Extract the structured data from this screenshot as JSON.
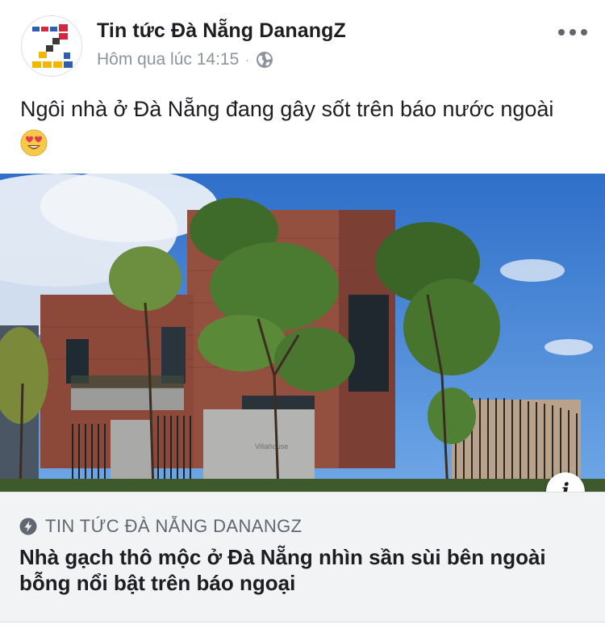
{
  "post": {
    "page_name": "Tin tức Đà Nẵng DanangZ",
    "timestamp": "Hôm qua lúc 14:15",
    "separator": "·",
    "privacy_icon": "globe-icon",
    "more_icon": "more-options-icon",
    "text": "Ngôi nhà ở Đà Nẵng đang gây sốt trên báo nước ngoài",
    "emoji": "heart-eyes-emoji"
  },
  "link": {
    "image_sign_text": "Villahouse",
    "info_label": "i",
    "source": "TIN TỨC ĐÀ NẴNG DANANGZ",
    "headline": "Nhà gạch thô mộc ở Đà Nẵng nhìn sần sùi bên ngoài bỗng nổi bật trên báo ngoại"
  },
  "colors": {
    "text_primary": "#1c1e21",
    "text_secondary": "#8d949e",
    "card_background": "#f2f3f5",
    "logo_red": "#d7263d",
    "logo_blue": "#2f5fb3",
    "logo_yellow": "#f2b705",
    "logo_dark": "#3a3a3a"
  }
}
